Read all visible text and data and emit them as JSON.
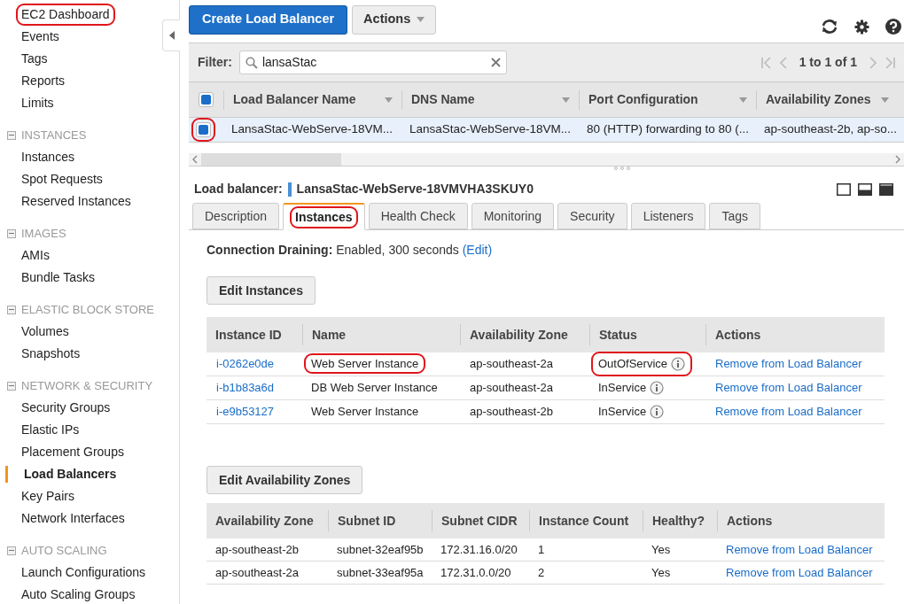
{
  "sidebar": {
    "sections": [
      {
        "items": [
          {
            "label": "EC2 Dashboard",
            "selected": false,
            "circled": true
          },
          {
            "label": "Events",
            "selected": false,
            "circled": false
          },
          {
            "label": "Tags",
            "selected": false,
            "circled": false
          },
          {
            "label": "Reports",
            "selected": false,
            "circled": false
          },
          {
            "label": "Limits",
            "selected": false,
            "circled": false
          }
        ]
      },
      {
        "heading": "INSTANCES",
        "expanded": true,
        "items": [
          {
            "label": "Instances",
            "selected": false,
            "circled": false
          },
          {
            "label": "Spot Requests",
            "selected": false,
            "circled": false
          },
          {
            "label": "Reserved Instances",
            "selected": false,
            "circled": false
          }
        ]
      },
      {
        "heading": "IMAGES",
        "expanded": true,
        "items": [
          {
            "label": "AMIs",
            "selected": false,
            "circled": false
          },
          {
            "label": "Bundle Tasks",
            "selected": false,
            "circled": false
          }
        ]
      },
      {
        "heading": "ELASTIC BLOCK STORE",
        "expanded": true,
        "items": [
          {
            "label": "Volumes",
            "selected": false,
            "circled": false
          },
          {
            "label": "Snapshots",
            "selected": false,
            "circled": false
          }
        ]
      },
      {
        "heading": "NETWORK & SECURITY",
        "expanded": true,
        "items": [
          {
            "label": "Security Groups",
            "selected": false,
            "circled": false
          },
          {
            "label": "Elastic IPs",
            "selected": false,
            "circled": false
          },
          {
            "label": "Placement Groups",
            "selected": false,
            "circled": false
          },
          {
            "label": "Load Balancers",
            "selected": true,
            "circled": false
          },
          {
            "label": "Key Pairs",
            "selected": false,
            "circled": false
          },
          {
            "label": "Network Interfaces",
            "selected": false,
            "circled": false
          }
        ]
      },
      {
        "heading": "AUTO SCALING",
        "expanded": true,
        "items": [
          {
            "label": "Launch Configurations",
            "selected": false,
            "circled": false
          },
          {
            "label": "Auto Scaling Groups",
            "selected": false,
            "circled": false
          }
        ]
      }
    ]
  },
  "toolbar": {
    "create_button": "Create Load Balancer",
    "actions_button": "Actions"
  },
  "filter": {
    "label": "Filter:",
    "value": "lansaStac",
    "pager": "1 to 1 of 1"
  },
  "lb_table": {
    "all_checked": true,
    "columns": [
      "Load Balancer Name",
      "DNS Name",
      "Port Configuration",
      "Availability Zones"
    ],
    "rows": [
      {
        "checked": true,
        "circled": true,
        "cells": [
          "LansaStac-WebServe-18VM...",
          "LansaStac-WebServe-18VM...",
          "80 (HTTP) forwarding to 80 (...",
          "ap-southeast-2b, ap-so..."
        ]
      }
    ]
  },
  "detail": {
    "label": "Load balancer:",
    "name": "LansaStac-WebServe-18VMVHA3SKUY0",
    "tabs": [
      {
        "label": "Description",
        "selected": false,
        "circled": false
      },
      {
        "label": "Instances",
        "selected": true,
        "circled": true
      },
      {
        "label": "Health Check",
        "selected": false,
        "circled": false
      },
      {
        "label": "Monitoring",
        "selected": false,
        "circled": false
      },
      {
        "label": "Security",
        "selected": false,
        "circled": false
      },
      {
        "label": "Listeners",
        "selected": false,
        "circled": false
      },
      {
        "label": "Tags",
        "selected": false,
        "circled": false
      }
    ],
    "draining": {
      "label": "Connection Draining:",
      "value": "Enabled, 300 seconds",
      "link": "(Edit)"
    },
    "instances": {
      "button": "Edit Instances",
      "columns": [
        "Instance ID",
        "Name",
        "Availability Zone",
        "Status",
        "Actions"
      ],
      "rows": [
        {
          "id": "i-0262e0de",
          "name": "Web Server Instance",
          "name_circled": true,
          "zone": "ap-southeast-2a",
          "status": "OutOfService",
          "status_circled": true,
          "action": "Remove from Load Balancer"
        },
        {
          "id": "i-b1b83a6d",
          "name": "DB Web Server Instance",
          "name_circled": false,
          "zone": "ap-southeast-2a",
          "status": "InService",
          "status_circled": false,
          "action": "Remove from Load Balancer"
        },
        {
          "id": "i-e9b53127",
          "name": "Web Server Instance",
          "name_circled": false,
          "zone": "ap-southeast-2b",
          "status": "InService",
          "status_circled": false,
          "action": "Remove from Load Balancer"
        }
      ]
    },
    "zones": {
      "button": "Edit Availability Zones",
      "columns": [
        "Availability Zone",
        "Subnet ID",
        "Subnet CIDR",
        "Instance Count",
        "Healthy?",
        "Actions"
      ],
      "rows": [
        {
          "cells": [
            "ap-southeast-2b",
            "subnet-32eaf95b",
            "172.31.16.0/20",
            "1",
            "Yes"
          ],
          "action": "Remove from Load Balancer"
        },
        {
          "cells": [
            "ap-southeast-2a",
            "subnet-33eaf95a",
            "172.31.0.0/20",
            "2",
            "Yes"
          ],
          "action": "Remove from Load Balancer"
        }
      ]
    }
  }
}
